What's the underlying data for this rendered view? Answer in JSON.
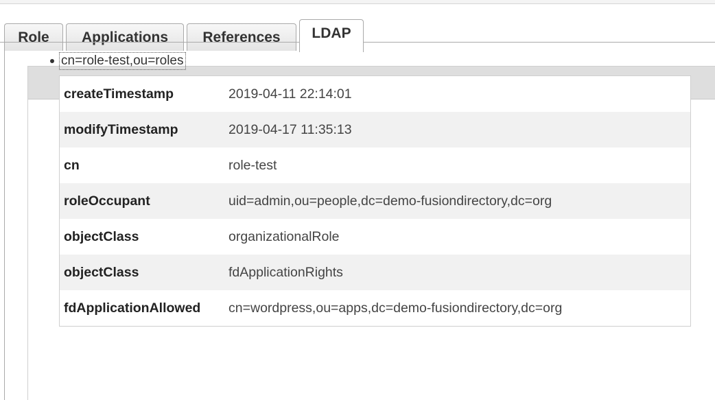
{
  "tabs": [
    {
      "label": "Role",
      "active": false
    },
    {
      "label": "Applications",
      "active": false
    },
    {
      "label": "References",
      "active": false
    },
    {
      "label": "LDAP",
      "active": true
    }
  ],
  "entry": {
    "dn": "cn=role-test,ou=roles",
    "attributes": [
      {
        "name": "createTimestamp",
        "value": "2019-04-11 22:14:01"
      },
      {
        "name": "modifyTimestamp",
        "value": "2019-04-17 11:35:13"
      },
      {
        "name": "cn",
        "value": "role-test"
      },
      {
        "name": "roleOccupant",
        "value": "uid=admin,ou=people,dc=demo-fusiondirectory,dc=org"
      },
      {
        "name": "objectClass",
        "value": "organizationalRole"
      },
      {
        "name": "objectClass",
        "value": "fdApplicationRights"
      },
      {
        "name": "fdApplicationAllowed",
        "value": "cn=wordpress,ou=apps,dc=demo-fusiondirectory,dc=org"
      }
    ]
  },
  "colors": {
    "panel_header": "#dedede",
    "row_alt": "#f1f1f1",
    "tab_border": "#a9a9a9"
  }
}
